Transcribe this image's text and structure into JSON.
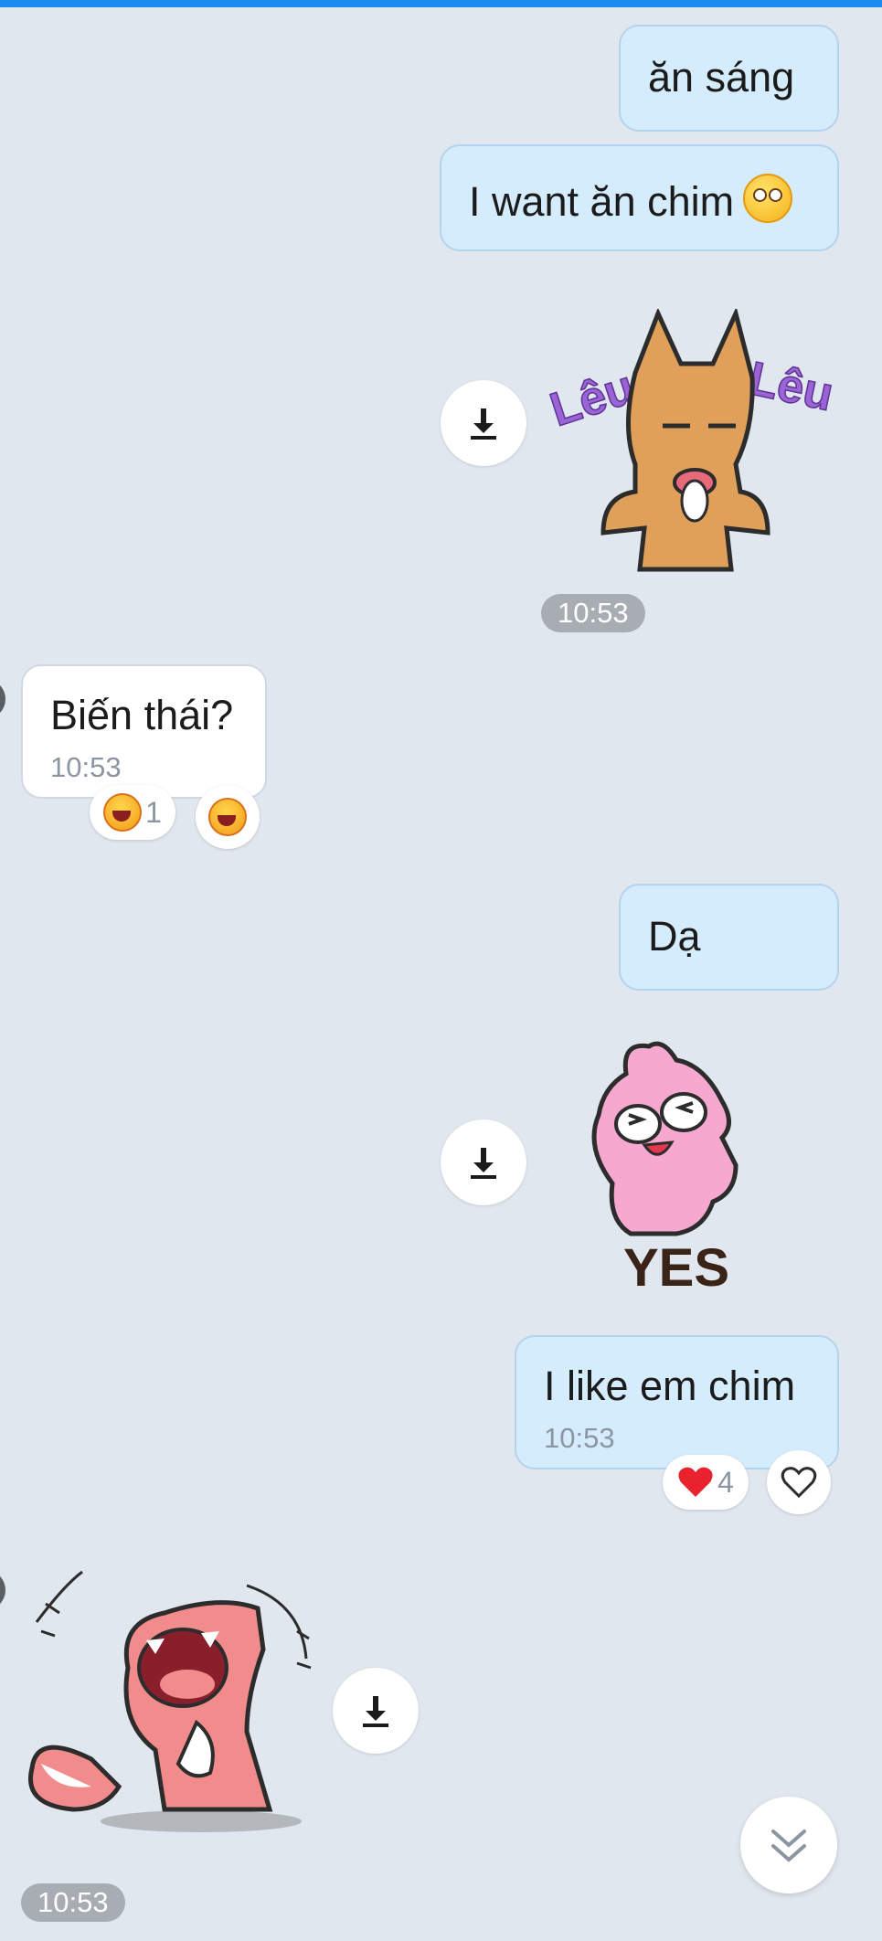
{
  "messages": {
    "m1": {
      "text": "ăn sáng"
    },
    "m2": {
      "text": "I want ăn chim"
    },
    "sticker1": {
      "text_left": "Lêu",
      "text_right": "Lêu"
    },
    "time_pill_1": "10:53",
    "m3": {
      "text": "Biến thái?",
      "time": "10:53",
      "reaction_count": "1"
    },
    "m4": {
      "text": "Dạ"
    },
    "sticker2": {
      "caption": "YES"
    },
    "m5": {
      "text": "I like em chim",
      "time": "10:53",
      "reaction_count": "4"
    },
    "time_pill_2": "10:53"
  },
  "colors": {
    "background": "#e1e7ef",
    "outgoing_bubble": "#d5ecfd",
    "incoming_bubble": "#ffffff",
    "accent": "#1a8cf0"
  },
  "icons": [
    "download-icon",
    "laugh-emoji-icon",
    "heart-icon",
    "heart-outline-icon",
    "chevron-double-down-icon",
    "rolling-eyes-emoji-icon"
  ]
}
